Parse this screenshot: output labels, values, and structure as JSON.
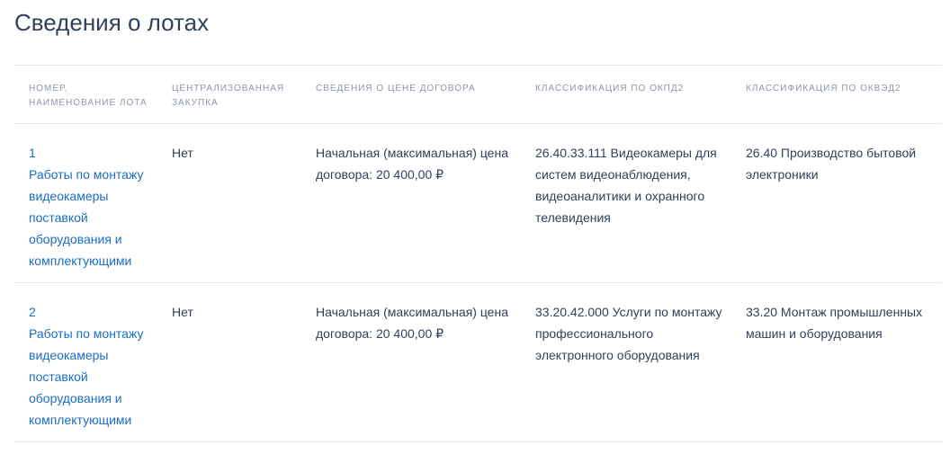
{
  "page_title": "Сведения о лотах",
  "columns": [
    "Номер, наименование лота",
    "Централизованная закупка",
    "Сведения о цене договора",
    "Классификация по ОКПД2",
    "Классификация по ОКВЭД2"
  ],
  "lots": [
    {
      "number": "1",
      "name": "Работы по монтажу видеокамеры поставкой оборудования и комплектующими",
      "centralized": "Нет",
      "price": "Начальная (максимальная) цена договора: 20 400,00 ₽",
      "okpd2": "26.40.33.111 Видеокамеры для систем видеонаблюдения, видеоаналитики и охранного телевидения",
      "okved2": "26.40 Производство бытовой электроники"
    },
    {
      "number": "2",
      "name": "Работы по монтажу видеокамеры поставкой оборудования и комплектующими",
      "centralized": "Нет",
      "price": "Начальная (максимальная) цена договора: 20 400,00 ₽",
      "okpd2": "33.20.42.000 Услуги по монтажу профессионального электронного оборудования",
      "okved2": "33.20 Монтаж промышленных машин и оборудования"
    }
  ]
}
